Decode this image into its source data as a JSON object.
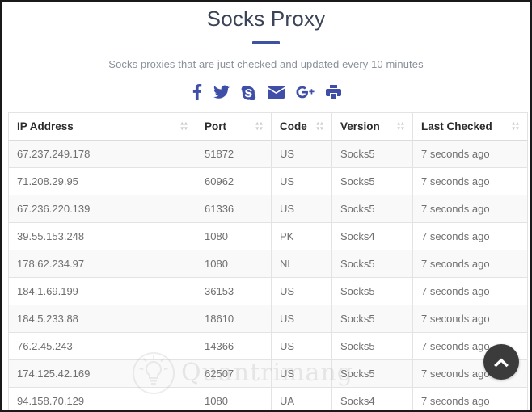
{
  "header": {
    "title": "Socks Proxy",
    "subtitle": "Socks proxies that are just checked and updated every 10 minutes"
  },
  "social": {
    "items": [
      {
        "name": "facebook-icon",
        "label": "f"
      },
      {
        "name": "twitter-icon",
        "label": "Twitter"
      },
      {
        "name": "skype-icon",
        "label": "S"
      },
      {
        "name": "email-icon",
        "label": "Email"
      },
      {
        "name": "google-plus-icon",
        "label": "G+"
      },
      {
        "name": "print-icon",
        "label": "Print"
      }
    ]
  },
  "table": {
    "columns": [
      "IP Address",
      "Port",
      "Code",
      "Version",
      "Last Checked"
    ],
    "rows": [
      {
        "ip": "67.237.249.178",
        "port": "51872",
        "code": "US",
        "version": "Socks5",
        "last_checked": "7 seconds ago"
      },
      {
        "ip": "71.208.29.95",
        "port": "60962",
        "code": "US",
        "version": "Socks5",
        "last_checked": "7 seconds ago"
      },
      {
        "ip": "67.236.220.139",
        "port": "61336",
        "code": "US",
        "version": "Socks5",
        "last_checked": "7 seconds ago"
      },
      {
        "ip": "39.55.153.248",
        "port": "1080",
        "code": "PK",
        "version": "Socks4",
        "last_checked": "7 seconds ago"
      },
      {
        "ip": "178.62.234.97",
        "port": "1080",
        "code": "NL",
        "version": "Socks5",
        "last_checked": "7 seconds ago"
      },
      {
        "ip": "184.1.69.199",
        "port": "36153",
        "code": "US",
        "version": "Socks5",
        "last_checked": "7 seconds ago"
      },
      {
        "ip": "184.5.233.88",
        "port": "18610",
        "code": "US",
        "version": "Socks5",
        "last_checked": "7 seconds ago"
      },
      {
        "ip": "76.2.45.243",
        "port": "14366",
        "code": "US",
        "version": "Socks5",
        "last_checked": "7 seconds ago"
      },
      {
        "ip": "174.125.42.169",
        "port": "62507",
        "code": "US",
        "version": "Socks5",
        "last_checked": "7 seconds ago"
      },
      {
        "ip": "94.158.70.129",
        "port": "1080",
        "code": "UA",
        "version": "Socks4",
        "last_checked": "7 seconds ago"
      }
    ]
  },
  "watermark": {
    "text": "Quantrimang"
  },
  "scroll_top": {
    "label": "Back to top"
  },
  "colors": {
    "accent": "#3f51a3",
    "title": "#3b4358",
    "subtitle": "#8a8f99",
    "cell_text": "#6f6f6f",
    "row_alt": "#f9f9f9",
    "border": "#e3e3e3",
    "scroll_top_bg": "#3b3b3b"
  }
}
